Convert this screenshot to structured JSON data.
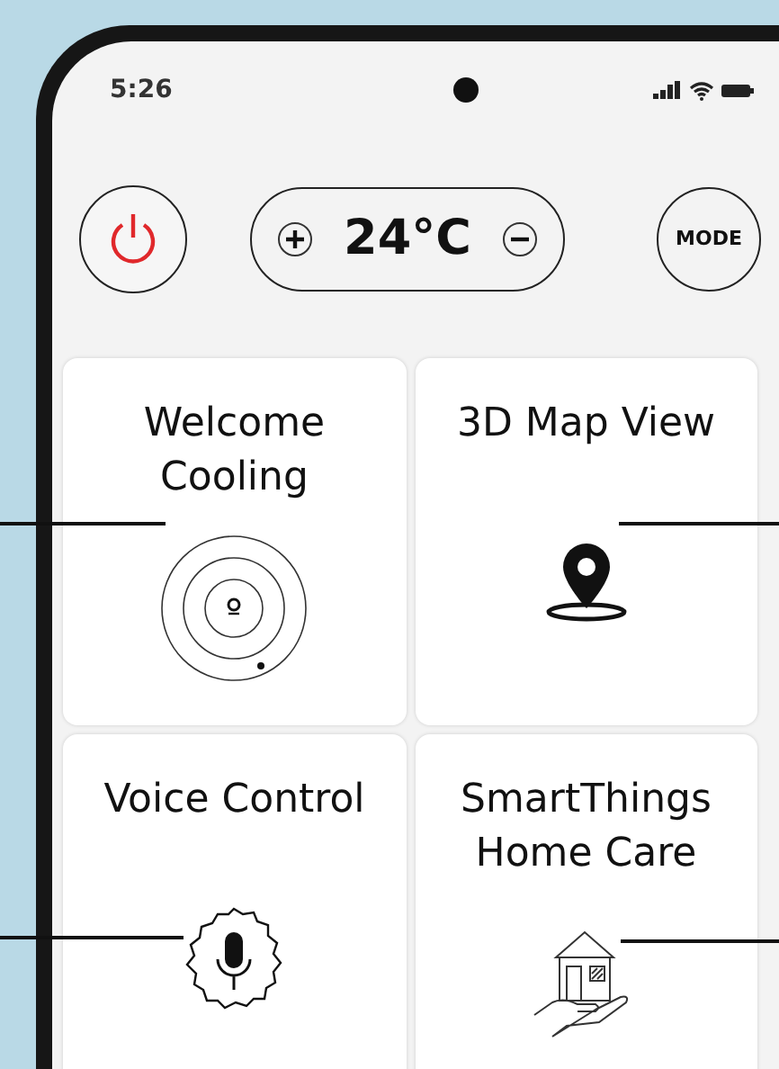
{
  "status_bar": {
    "time": "5:26"
  },
  "controls": {
    "temperature": "24°C",
    "mode_button": "MODE"
  },
  "cards": [
    {
      "title": "Welcome Cooling",
      "kind": "radar"
    },
    {
      "title": "3D Map View",
      "kind": "pin"
    },
    {
      "title": "Voice Control",
      "kind": "mic"
    },
    {
      "title": "SmartThings Home Care",
      "kind": "home"
    }
  ]
}
